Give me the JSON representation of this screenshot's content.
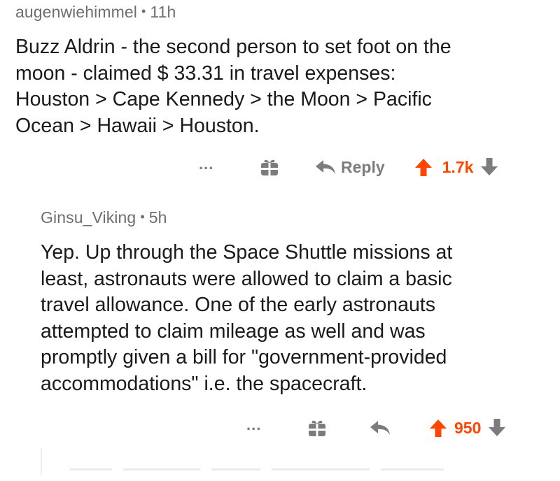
{
  "comments": [
    {
      "username": "augenwiehimmel",
      "separator": "•",
      "time": "11h",
      "text": "Buzz Aldrin - the second person to set foot on the\nmoon - claimed $ 33.31 in travel expenses:\nHouston > Cape Kennedy > the Moon > Pacific\nOcean > Hawaii > Houston.",
      "actions": {
        "more_label": "...",
        "award_icon": "gift-icon",
        "reply_icon": "reply-arrow-icon",
        "reply_label": "Reply",
        "upvote_icon": "upvote-arrow-icon",
        "score": "1.7k",
        "downvote_icon": "downvote-arrow-icon"
      }
    },
    {
      "username": "Ginsu_Viking",
      "separator": "•",
      "time": "5h",
      "text": "Yep. Up through the Space Shuttle missions at\nleast, astronauts were allowed to claim a basic\ntravel allowance. One of the early astronauts\nattempted to claim mileage as well and was\npromptly given a bill for \"government-provided\naccommodations\" i.e. the spacecraft.",
      "actions": {
        "more_label": "...",
        "award_icon": "gift-icon",
        "reply_icon": "reply-arrow-icon",
        "reply_label": "",
        "upvote_icon": "upvote-arrow-icon",
        "score": "950",
        "downvote_icon": "downvote-arrow-icon"
      }
    }
  ],
  "colors": {
    "score": "#ff4500",
    "meta": "#6e6e72",
    "icon": "#7c7c80",
    "text": "#1a1a1b"
  }
}
